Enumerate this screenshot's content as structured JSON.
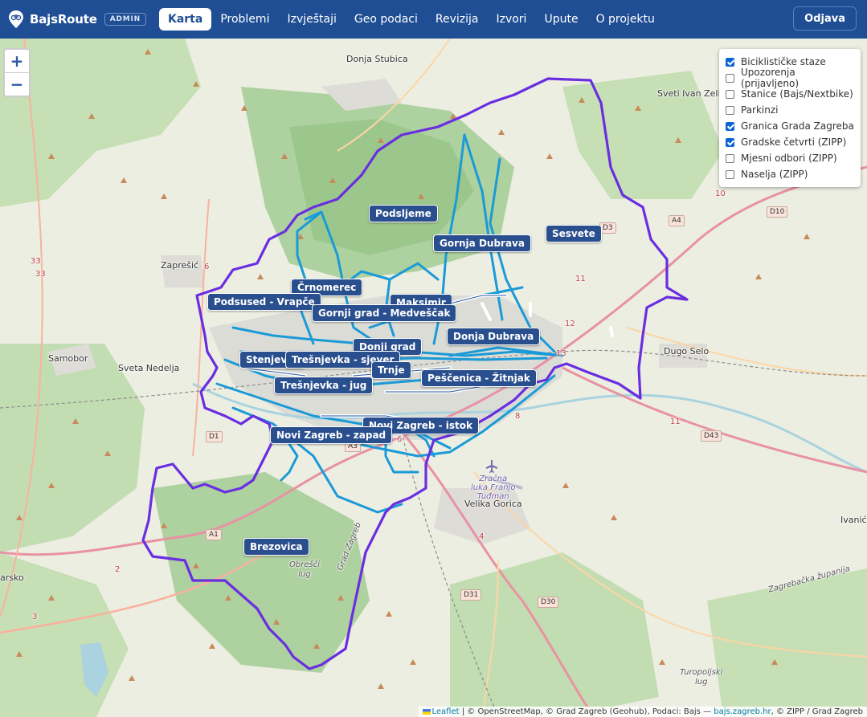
{
  "app": {
    "brand": "BajsRoute",
    "badge": "ADMIN",
    "logout": "Odjava"
  },
  "nav": {
    "items": [
      {
        "label": "Karta",
        "active": true
      },
      {
        "label": "Problemi"
      },
      {
        "label": "Izvještaji"
      },
      {
        "label": "Geo podaci"
      },
      {
        "label": "Revizija"
      },
      {
        "label": "Izvori"
      },
      {
        "label": "Upute"
      },
      {
        "label": "O projektu"
      }
    ]
  },
  "map": {
    "zoom_in": "+",
    "zoom_out": "−",
    "layers": [
      {
        "label": "Biciklističke staze",
        "checked": true
      },
      {
        "label": "Upozorenja (prijavljeno)",
        "checked": false
      },
      {
        "label": "Stanice (Bajs/Nextbike)",
        "checked": false
      },
      {
        "label": "Parkinzi",
        "checked": false
      },
      {
        "label": "Granica Grada Zagreba",
        "checked": true
      },
      {
        "label": "Gradske četvrti (ZIPP)",
        "checked": true
      },
      {
        "label": "Mjesni odbori (ZIPP)",
        "checked": false
      },
      {
        "label": "Naselja (ZIPP)",
        "checked": false
      }
    ],
    "districts": {
      "podsljeme": "Podsljeme",
      "gornja_dubrava": "Gornja Dubrava",
      "sesvete": "Sesvete",
      "crnomerec": "Črnomerec",
      "podsused": "Podsused - Vrapče",
      "maksimir": "Maksimir",
      "gornji_grad": "Gornji grad - Medveščak",
      "donja_dubrava": "Donja Dubrava",
      "donji_grad": "Donji grad",
      "stenjevec": "Stenjevec",
      "tresnjevka_sjever": "Trešnjevka - sjever",
      "trnje": "Trnje",
      "pescenica": "Peščenica - Žitnjak",
      "tresnjevka_jug": "Trešnjevka - jug",
      "novi_zagreb_istok": "Novi Zagreb - istok",
      "novi_zagreb_zapad": "Novi Zagreb - zapad",
      "brezovica": "Brezovica"
    },
    "towns": {
      "donja_stubica": "Donja Stubica",
      "sveti_ivan_zelina": "Sveti Ivan Zelin",
      "zapresic": "Zaprešić",
      "samobor": "Samobor",
      "sveta_nedelja": "Sveta Nedelja",
      "dugo_selo": "Dugo Selo",
      "velika_gorica": "Velika Gorica",
      "ivanic": "Ivanić",
      "sko": "arsko",
      "obresci_lug": "Obrešči\nlug",
      "turopoljski_lug": "Turopoljski\nlug",
      "zracna_luka": "Zračna\nluka Franjo\nTuđman",
      "grad_zagreb_road": "Grad Zagreb",
      "zagrebacka_zupanija": "Zagrebačka županija"
    },
    "roads": {
      "a4": "A4",
      "d10": "D10",
      "d3": "D3",
      "d1": "D1",
      "a3": "A3",
      "a1": "A1",
      "d31": "D31",
      "d30": "D30",
      "d43": "D43"
    },
    "road_numbers": {
      "n10": "10",
      "n33a": "33",
      "n33b": "33",
      "n6": "6",
      "n11a": "11",
      "n12": "12",
      "n13": "13",
      "n11b": "11",
      "n8": "8",
      "n4": "4",
      "n2": "2",
      "n3": "3",
      "n5": "5",
      "n6b": "6"
    },
    "attribution": {
      "leaflet": "Leaflet",
      "text": " | © OpenStreetMap, © Grad Zagreb (Geohub), Podaci: Bajs — ",
      "link": "bajs.zagreb.hr",
      "text2": ", © ZIPP / Grad Zagreb"
    },
    "colors": {
      "navbar": "#1f4e94",
      "boundary": "#6a2ee0",
      "cycle_path": "#1a9ad6",
      "district_label": "#2a4f8e",
      "forest": "#aed1a0"
    }
  }
}
